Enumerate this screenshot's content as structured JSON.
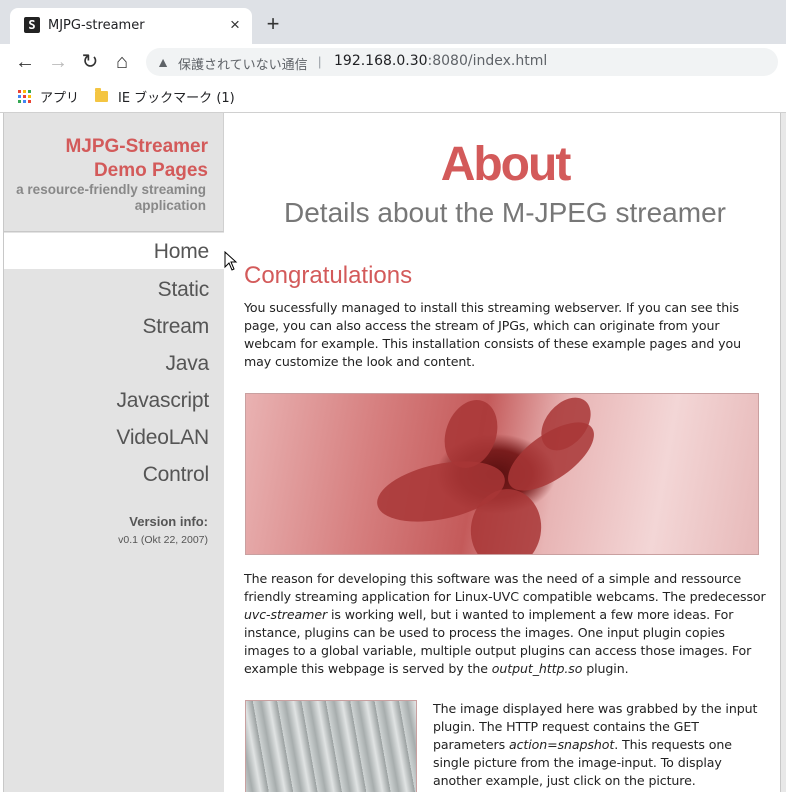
{
  "browser": {
    "tab_title": "MJPG-streamer",
    "tab_favicon": "S",
    "close_glyph": "×",
    "new_tab_glyph": "+",
    "back_glyph": "←",
    "forward_glyph": "→",
    "reload_glyph": "↻",
    "home_glyph": "⌂",
    "security_text": "保護されていない通信",
    "url_host": "192.168.0.30",
    "url_rest": ":8080/index.html",
    "bookmarks": [
      {
        "label": "アプリ",
        "icon": "apps-grid-icon"
      },
      {
        "label": "IE ブックマーク (1)",
        "icon": "folder-icon"
      }
    ]
  },
  "sidebar": {
    "title_line1": "MJPG-Streamer",
    "title_line2": "Demo Pages",
    "subtitle_line1": "a resource-friendly streaming",
    "subtitle_line2": "application",
    "nav": [
      "Home",
      "Static",
      "Stream",
      "Java",
      "Javascript",
      "VideoLAN",
      "Control"
    ],
    "active": "Home",
    "version_label": "Version info:",
    "version_value": "v0.1 (Okt 22, 2007)"
  },
  "content": {
    "heading": "About",
    "subheading": "Details about the M-JPEG streamer",
    "section_title": "Congratulations",
    "p1": "You sucessfully managed to install this streaming webserver. If you can see this page, you can also access the stream of JPGs, which can originate from your webcam for example. This installation consists of these example pages and you may customize the look and content.",
    "p2_a": "The reason for developing this software was the need of a simple and ressource friendly streaming application for Linux-UVC compatible webcams. The predecessor ",
    "p2_em1": "uvc-streamer",
    "p2_b": " is working well, but i wanted to implement a few more ideas. For instance, plugins can be used to process the images. One input plugin copies images to a global variable, multiple output plugins can access those images. For example this webpage is served by the ",
    "p2_em2": "output_http.so",
    "p2_c": " plugin.",
    "p3_a": "The image displayed here was grabbed by the input plugin. The HTTP request contains the GET parameters ",
    "p3_em": "action=snapshot",
    "p3_b": ". This requests one single picture from the image-input. To display another example, just click on the picture."
  },
  "colors": {
    "accent": "#d35a5a",
    "sidebar_bg": "#e3e3e3"
  }
}
